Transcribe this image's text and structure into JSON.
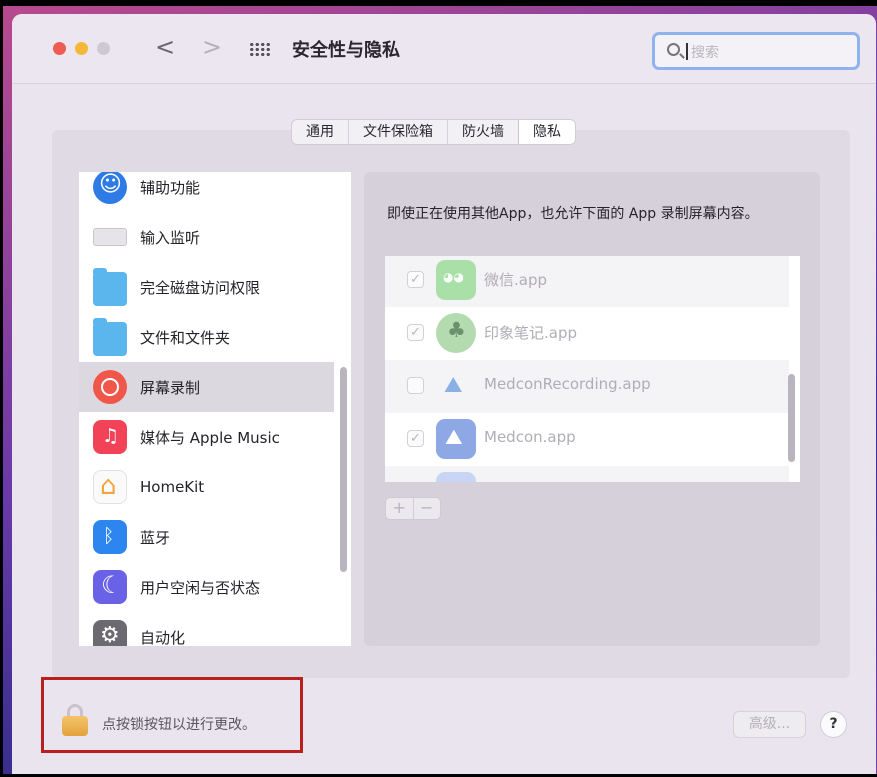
{
  "window": {
    "title": "安全性与隐私",
    "nav_back": "<",
    "nav_forward": ">"
  },
  "search": {
    "placeholder": "搜索"
  },
  "tabs": [
    {
      "label": "通用",
      "active": false
    },
    {
      "label": "文件保险箱",
      "active": false
    },
    {
      "label": "防火墙",
      "active": false
    },
    {
      "label": "隐私",
      "active": true
    }
  ],
  "sidebar": {
    "items": [
      {
        "label": "辅助功能",
        "icon": "accessibility-icon"
      },
      {
        "label": "输入监听",
        "icon": "keyboard-icon"
      },
      {
        "label": "完全磁盘访问权限",
        "icon": "folder-icon"
      },
      {
        "label": "文件和文件夹",
        "icon": "folder-icon"
      },
      {
        "label": "屏幕录制",
        "icon": "screen-recording-icon",
        "selected": true
      },
      {
        "label": "媒体与 Apple Music",
        "icon": "music-icon"
      },
      {
        "label": "HomeKit",
        "icon": "home-icon"
      },
      {
        "label": "蓝牙",
        "icon": "bluetooth-icon"
      },
      {
        "label": "用户空闲与否状态",
        "icon": "moon-icon"
      },
      {
        "label": "自动化",
        "icon": "gear-icon"
      }
    ]
  },
  "detail": {
    "description": "即使正在使用其他App，也允许下面的 App 录制屏幕内容。",
    "apps": [
      {
        "name": "微信.app",
        "checked": true,
        "icon": "wechat-icon"
      },
      {
        "name": "印象笔记.app",
        "checked": true,
        "icon": "evernote-icon"
      },
      {
        "name": "MedconRecording.app",
        "checked": false,
        "icon": "medcon-recording-icon"
      },
      {
        "name": "Medcon.app",
        "checked": true,
        "icon": "medcon-icon"
      }
    ],
    "add_label": "+",
    "remove_label": "−",
    "checkmark": "✓"
  },
  "footer": {
    "lock_text": "点按锁按钮以进行更改。",
    "advanced_label": "高级...",
    "help_label": "?"
  },
  "colors": {
    "accent": "#8fb3ee",
    "highlight_box": "#b82020",
    "selected_row": "#dcd8df"
  }
}
